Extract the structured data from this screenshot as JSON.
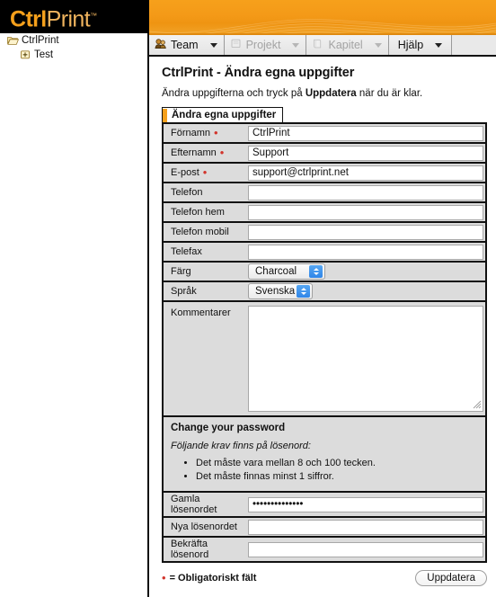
{
  "brand": {
    "logo_bold": "Ctrl",
    "logo_light": "Print",
    "logo_tm": "™",
    "accent_orange": "#f5a01c",
    "required_red": "#d2352c"
  },
  "sidebar": {
    "items": [
      {
        "label": "CtrlPrint",
        "icon": "open-folder-icon",
        "level": 0
      },
      {
        "label": "Test",
        "icon": "expand-plus-icon",
        "level": 1
      }
    ]
  },
  "navbar": {
    "tabs": [
      {
        "label": "Team",
        "icon": "team-icon",
        "enabled": true,
        "has_caret": true
      },
      {
        "label": "Projekt",
        "icon": "document-icon",
        "enabled": false,
        "has_caret": true
      },
      {
        "label": "Kapitel",
        "icon": "chapter-icon",
        "enabled": false,
        "has_caret": true
      },
      {
        "label": "Hjälp",
        "icon": "",
        "enabled": true,
        "has_caret": true
      }
    ]
  },
  "page": {
    "title": "CtrlPrint - Ändra egna uppgifter",
    "subtitle_before": "Ändra uppgifterna och tryck på ",
    "subtitle_bold": "Uppdatera",
    "subtitle_after": " när du är klar.",
    "pane_tab": "Ändra egna uppgifter"
  },
  "form": {
    "fields": [
      {
        "label": "Förnamn",
        "required": true,
        "value": "CtrlPrint",
        "placeholder": "",
        "type": "text"
      },
      {
        "label": "Efternamn",
        "required": true,
        "value": "Support",
        "placeholder": "",
        "type": "text"
      },
      {
        "label": "E-post",
        "required": true,
        "value": "support@ctrlprint.net",
        "placeholder": "",
        "type": "text"
      },
      {
        "label": "Telefon",
        "required": false,
        "value": "",
        "placeholder": "",
        "type": "text"
      },
      {
        "label": "Telefon hem",
        "required": false,
        "value": "",
        "placeholder": "",
        "type": "text"
      },
      {
        "label": "Telefon mobil",
        "required": false,
        "value": "",
        "placeholder": "",
        "type": "text"
      },
      {
        "label": "Telefax",
        "required": false,
        "value": "",
        "placeholder": "",
        "type": "text"
      }
    ],
    "color_select": {
      "label": "Färg",
      "value": "Charcoal"
    },
    "language_select": {
      "label": "Språk",
      "value": "Svenska"
    },
    "comments": {
      "label": "Kommentarer",
      "value": "",
      "placeholder": ""
    }
  },
  "password": {
    "title": "Change your password",
    "note": "Följande krav finns på lösenord:",
    "rules": [
      "Det måste vara mellan 8 och 100 tecken.",
      "Det måste finnas minst 1 siffror."
    ],
    "fields": [
      {
        "label": "Gamla lösenordet",
        "value": "••••••••••••••",
        "placeholder": ""
      },
      {
        "label": "Nya lösenordet",
        "value": "",
        "placeholder": ""
      },
      {
        "label": "Bekräfta lösenord",
        "value": "",
        "placeholder": ""
      }
    ]
  },
  "footer": {
    "required_marker": "•",
    "required_text": "= Obligatoriskt fält",
    "submit_label": "Uppdatera"
  }
}
